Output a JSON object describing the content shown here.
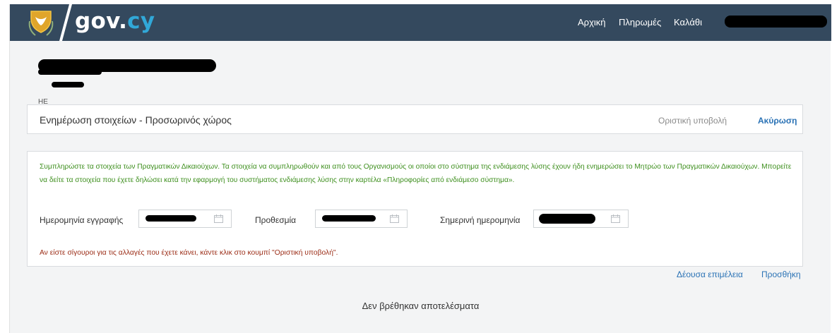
{
  "header": {
    "logo": {
      "prefix": "gov.",
      "suffix": "cy"
    },
    "nav": [
      {
        "label": "Αρχική"
      },
      {
        "label": "Πληρωμές"
      },
      {
        "label": "Καλάθι"
      }
    ],
    "background": "#34495e"
  },
  "user": {
    "id_prefix": "HE"
  },
  "title_panel": {
    "title": "Ενημέρωση στοιχείων - Προσωρινός χώρος",
    "final_submit": "Οριστική υποβολή",
    "cancel": "Ακύρωση"
  },
  "form": {
    "info": "Συμπληρώστε τα στοιχεία των Πραγματικών Δικαιούχων. Τα στοιχεία να συμπληρωθούν και από τους Οργανισμούς οι οποίοι στο σύστημα της ενδιάμεσης λύσης έχουν ήδη ενημερώσει το Μητρώο των Πραγματικών Δικαιούχων. Μπορείτε να δείτε τα στοιχεία που έχετε δηλώσει κατά την εφαρμογή του συστήματος ενδιάμεσης λύσης στην καρτέλα «Πληροφορίες από ενδιάμεσο σύστημα».",
    "fields": [
      {
        "label": "Ημερομηνία εγγραφής",
        "icon": "calendar-icon"
      },
      {
        "label": "Προθεσμία",
        "icon": "calendar-icon"
      },
      {
        "label": "Σημερινή ημερομηνία",
        "icon": "calendar-icon"
      }
    ],
    "warning": "Αν είστε σίγουροι για τις αλλαγές που έχετε κάνει, κάντε κλικ στο κουμπί \"Οριστική υποβολή\"."
  },
  "actions": {
    "due_diligence": "Δέουσα επιμέλεια",
    "add": "Προσθήκη"
  },
  "results": {
    "empty": "Δεν βρέθηκαν αποτελέσματα"
  },
  "colors": {
    "link": "#2a72b5",
    "info_text": "#3e8f1e",
    "warning_text": "#9b2c16",
    "logo_accent": "#31a8d8"
  }
}
